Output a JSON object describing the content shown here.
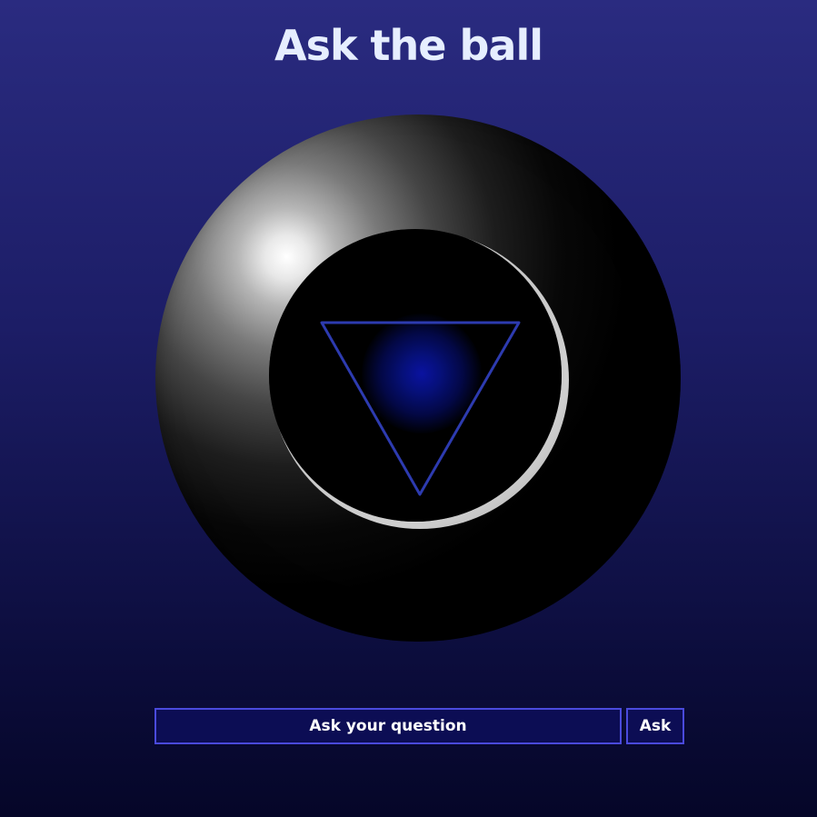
{
  "page": {
    "title": "Ask the ball"
  },
  "ball": {
    "icon": "magic-8-ball-icon",
    "window_icon": "triangle-icon",
    "answer_text": ""
  },
  "form": {
    "question_placeholder": "Ask your question",
    "question_value": "",
    "ask_label": "Ask"
  },
  "colors": {
    "background_top": "#2a2b80",
    "background_bottom": "#050628",
    "title": "#e6eeff",
    "accent_border": "#4a4adc",
    "field_background": "#0c0d54",
    "triangle_stroke": "#2d3bb0"
  }
}
